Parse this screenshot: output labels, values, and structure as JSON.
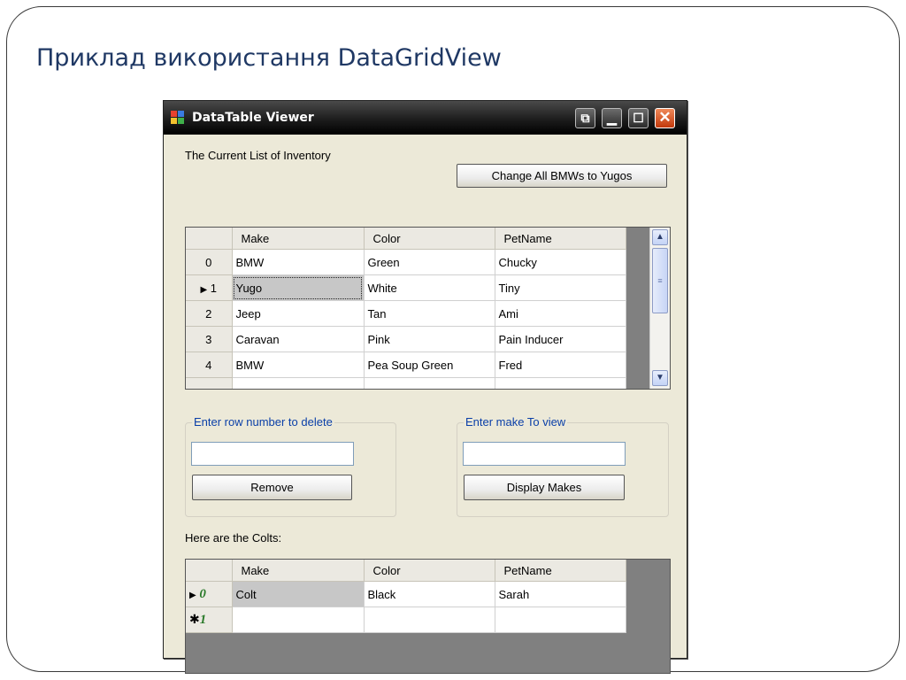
{
  "slide": {
    "title": "Приклад використання DataGridView"
  },
  "window": {
    "title": "DataTable Viewer",
    "controls": {
      "extra": "⧉",
      "minimize": "▁",
      "maximize": "☐",
      "close": "✕"
    }
  },
  "inventory": {
    "label": "The Current List of Inventory",
    "change_button": "Change All BMWs to Yugos",
    "columns": [
      "Make",
      "Color",
      "PetName"
    ],
    "rows": [
      {
        "index": "0",
        "make": "BMW",
        "color": "Green",
        "petname": "Chucky"
      },
      {
        "index": "1",
        "make": "Yugo",
        "color": "White",
        "petname": "Tiny"
      },
      {
        "index": "2",
        "make": "Jeep",
        "color": "Tan",
        "petname": "Ami"
      },
      {
        "index": "3",
        "make": "Caravan",
        "color": "Pink",
        "petname": "Pain Inducer"
      },
      {
        "index": "4",
        "make": "BMW",
        "color": "Pea Soup Green",
        "petname": "Fred"
      }
    ],
    "current_row_marker": "▶"
  },
  "delete_group": {
    "title": "Enter row number to delete",
    "input_value": "",
    "button": "Remove"
  },
  "view_group": {
    "title": "Enter make To view",
    "input_value": "",
    "button": "Display Makes"
  },
  "colts": {
    "label": "Here are the Colts:",
    "columns": [
      "Make",
      "Color",
      "PetName"
    ],
    "rows": [
      {
        "marker": "▶",
        "index": "0",
        "make": "Colt",
        "color": "Black",
        "petname": "Sarah"
      },
      {
        "marker": "✱",
        "index": "1",
        "make": "",
        "color": "",
        "petname": ""
      }
    ]
  },
  "icons": {
    "scroll_up": "scroll-up-arrow-icon",
    "scroll_down": "scroll-down-arrow-icon",
    "grip": "scroll-grip-icon"
  }
}
